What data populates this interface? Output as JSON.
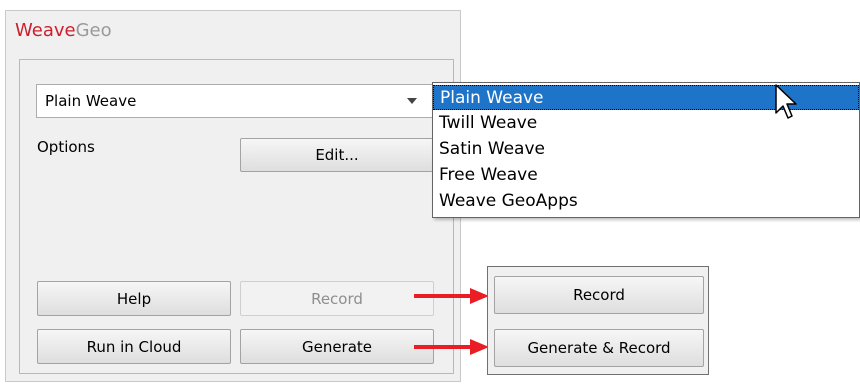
{
  "app": {
    "title_part1": "Weave",
    "title_part2": "Geo"
  },
  "weave_select": {
    "value": "Plain Weave",
    "options": [
      "Plain Weave",
      "Twill Weave",
      "Satin Weave",
      "Free Weave",
      "Weave GeoApps"
    ]
  },
  "options": {
    "label": "Options",
    "edit_button": "Edit..."
  },
  "buttons": {
    "help": "Help",
    "record": "Record",
    "run_in_cloud": "Run in Cloud",
    "generate": "Generate"
  },
  "callout": {
    "record": "Record",
    "generate_and_record": "Generate & Record"
  },
  "colors": {
    "brand_red": "#cc1f2d",
    "brand_gray": "#9a9a9a",
    "selection_blue": "#1e74c9",
    "annotation_red": "#ea1c24"
  }
}
